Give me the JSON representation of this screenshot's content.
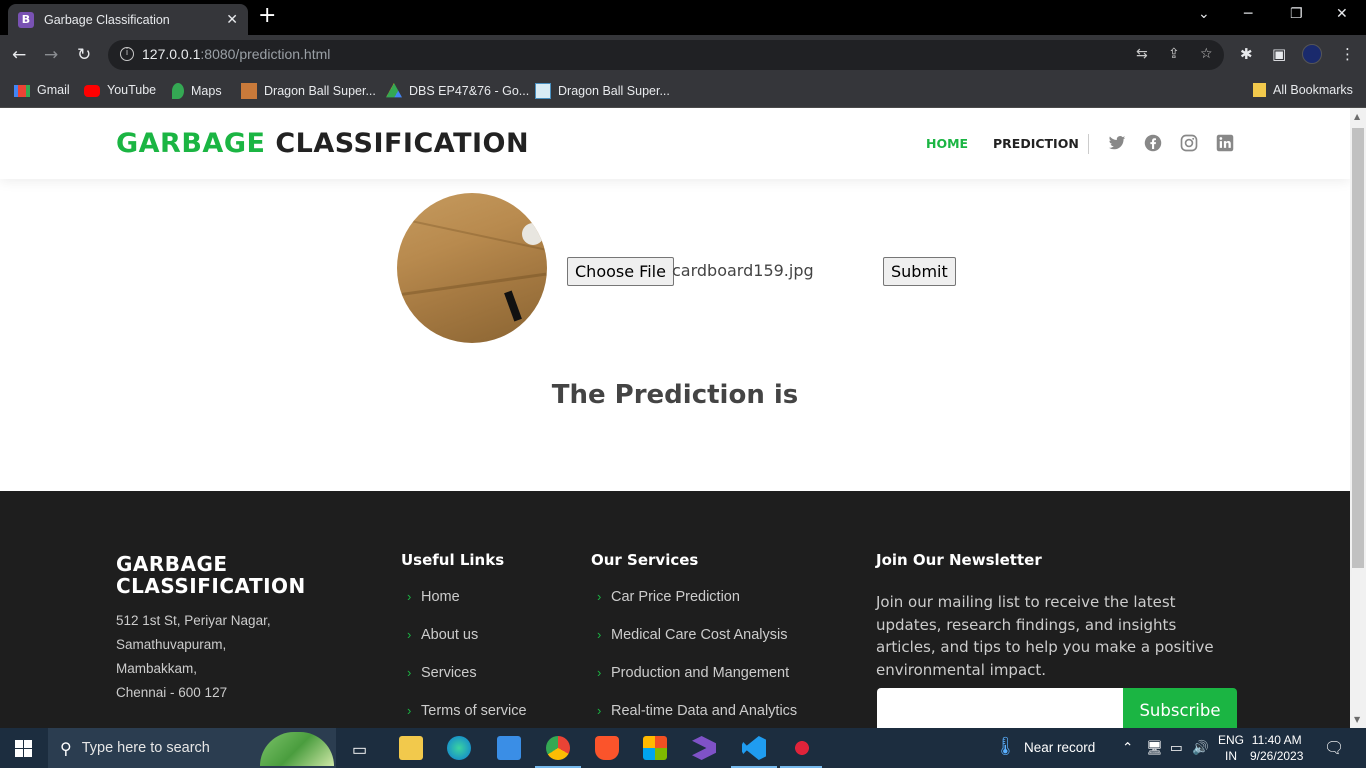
{
  "browser": {
    "tab_title": "Garbage Classification",
    "tab_favicon": "B",
    "url_host": "127.0.0.1",
    "url_rest": ":8080/prediction.html",
    "bookmarks": [
      "Gmail",
      "YouTube",
      "Maps",
      "Dragon Ball Super...",
      "DBS EP47&76 - Go...",
      "Dragon Ball Super..."
    ],
    "all_bookmarks": "All Bookmarks"
  },
  "header": {
    "logo_green": "GARBAGE",
    "logo_dark": "CLASSIFICATION",
    "nav": [
      "HOME",
      "PREDICTION"
    ],
    "accent": "#1bb543"
  },
  "upload": {
    "choose_label": "Choose File",
    "file_name": "cardboard159.jpg",
    "submit_label": "Submit"
  },
  "prediction": {
    "text": "The Prediction is"
  },
  "footer": {
    "logo_line1": "GARBAGE",
    "logo_line2": "CLASSIFICATION",
    "address": [
      "512 1st St, Periyar Nagar,",
      "Samathuvapuram,",
      "Mambakkam,",
      "Chennai - 600 127"
    ],
    "useful_title": "Useful Links",
    "useful_links": [
      "Home",
      "About us",
      "Services",
      "Terms of service"
    ],
    "services_title": "Our Services",
    "services": [
      "Car Price Prediction",
      "Medical Care Cost Analysis",
      "Production and Mangement",
      "Real-time Data and Analytics"
    ],
    "newsletter_title": "Join Our Newsletter",
    "newsletter_text": "Join our mailing list to receive the latest updates, research findings, and insights articles, and tips to help you make a positive environmental impact.",
    "subscribe_label": "Subscribe"
  },
  "taskbar": {
    "search_text": "Type here to search",
    "weather": "Near record",
    "lang1": "ENG",
    "lang2": "IN",
    "time": "11:40 AM",
    "date": "9/26/2023"
  }
}
